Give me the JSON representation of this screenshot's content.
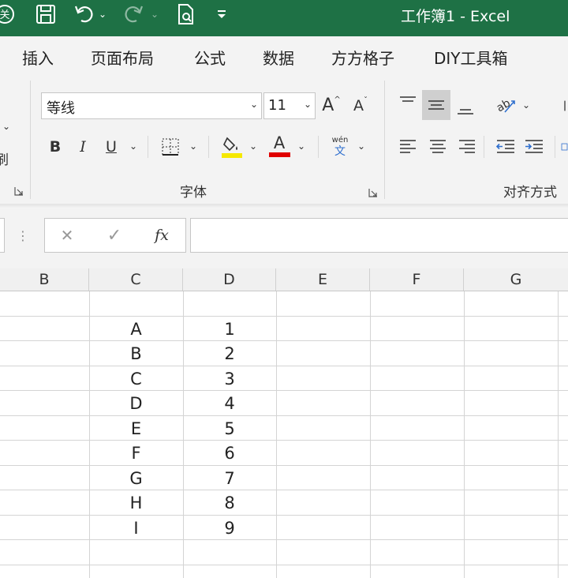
{
  "titlebar": {
    "title": "工作簿1  -  Excel",
    "icons": [
      "autosave-icon",
      "save-icon",
      "undo-icon",
      "undo-dropdown-icon",
      "redo-icon",
      "redo-dropdown-icon",
      "print-preview-icon",
      "customize-quick-access-icon"
    ]
  },
  "tabs": [
    "插入",
    "页面布局",
    "公式",
    "数据",
    "方方格子",
    "DIY工具箱"
  ],
  "font": {
    "name": "等线",
    "size": "11",
    "bold": "B",
    "italic": "I",
    "underline": "U",
    "increase_font": "A",
    "decrease_font": "A",
    "font_color_letter": "A",
    "phonetic_top": "wén",
    "phonetic_bottom": "文",
    "group_label": "字体",
    "highlight_color": "#f5e800",
    "font_color": "#e00000"
  },
  "alignment": {
    "group_label": "对齐方式",
    "active_button": "center-vertical-align"
  },
  "clipboard": {
    "partial_label": "刷"
  },
  "formula_bar": {
    "cancel": "✕",
    "enter": "✓",
    "fx": "fx",
    "value": ""
  },
  "sheet": {
    "column_headers": [
      "B",
      "C",
      "D",
      "E",
      "F",
      "G"
    ],
    "rows": [
      {
        "C": "",
        "D": ""
      },
      {
        "C": "A",
        "D": "1"
      },
      {
        "C": "B",
        "D": "2"
      },
      {
        "C": "C",
        "D": "3"
      },
      {
        "C": "D",
        "D": "4"
      },
      {
        "C": "E",
        "D": "5"
      },
      {
        "C": "F",
        "D": "6"
      },
      {
        "C": "G",
        "D": "7"
      },
      {
        "C": "H",
        "D": "8"
      },
      {
        "C": "I",
        "D": "9"
      },
      {
        "C": "",
        "D": ""
      },
      {
        "C": "",
        "D": ""
      }
    ]
  },
  "colors": {
    "title_green": "#1e7145",
    "ribbon_bg": "#f3f3f3"
  }
}
